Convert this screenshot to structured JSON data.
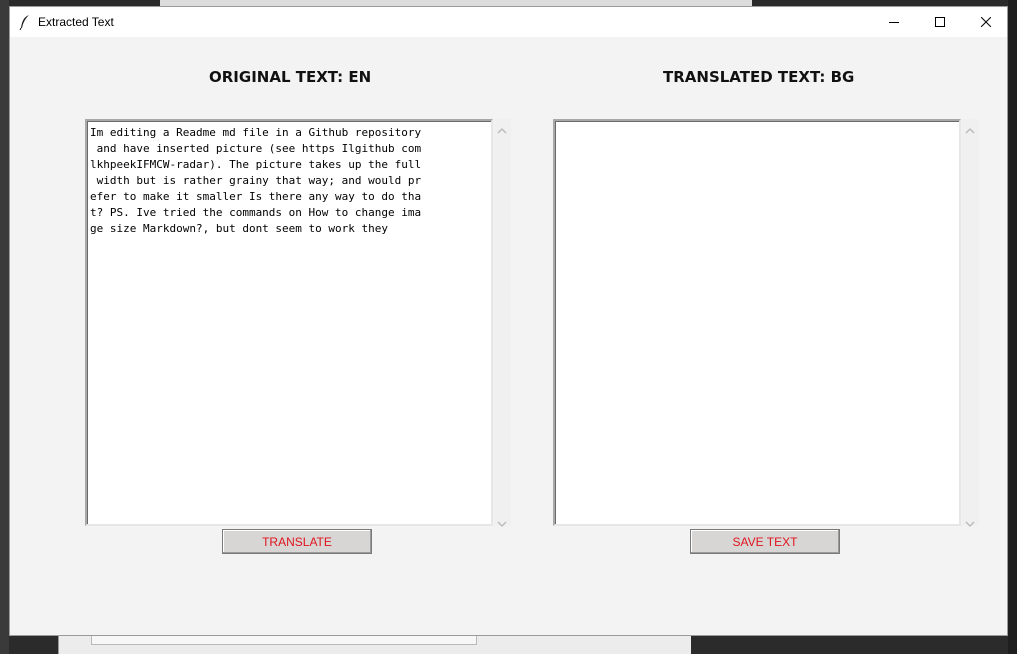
{
  "window": {
    "title": "Extracted Text",
    "controls": {
      "minimize_icon": "minimize-icon",
      "maximize_icon": "maximize-icon",
      "close_icon": "close-icon"
    }
  },
  "original": {
    "heading": "ORIGINAL TEXT: EN",
    "lines": [
      "Im editing a Readme md file in a Github repository",
      " and have inserted picture (see https Ilgithub com",
      "lkhpeekIFMCW-radar). The picture takes up the full",
      " width but is rather grainy that way; and would pr",
      "efer to make it smaller Is there any way to do tha",
      "t? PS. Ive tried the commands on How to change ima",
      "ge size Markdown?, but dont seem to work they"
    ]
  },
  "translated": {
    "heading": "TRANSLATED TEXT: BG",
    "text": ""
  },
  "buttons": {
    "translate": "TRANSLATE",
    "save": "SAVE TEXT"
  },
  "colors": {
    "button_text": "#e0141e",
    "button_face": "#d8d5d5",
    "window_bg": "#f3f3f3"
  }
}
